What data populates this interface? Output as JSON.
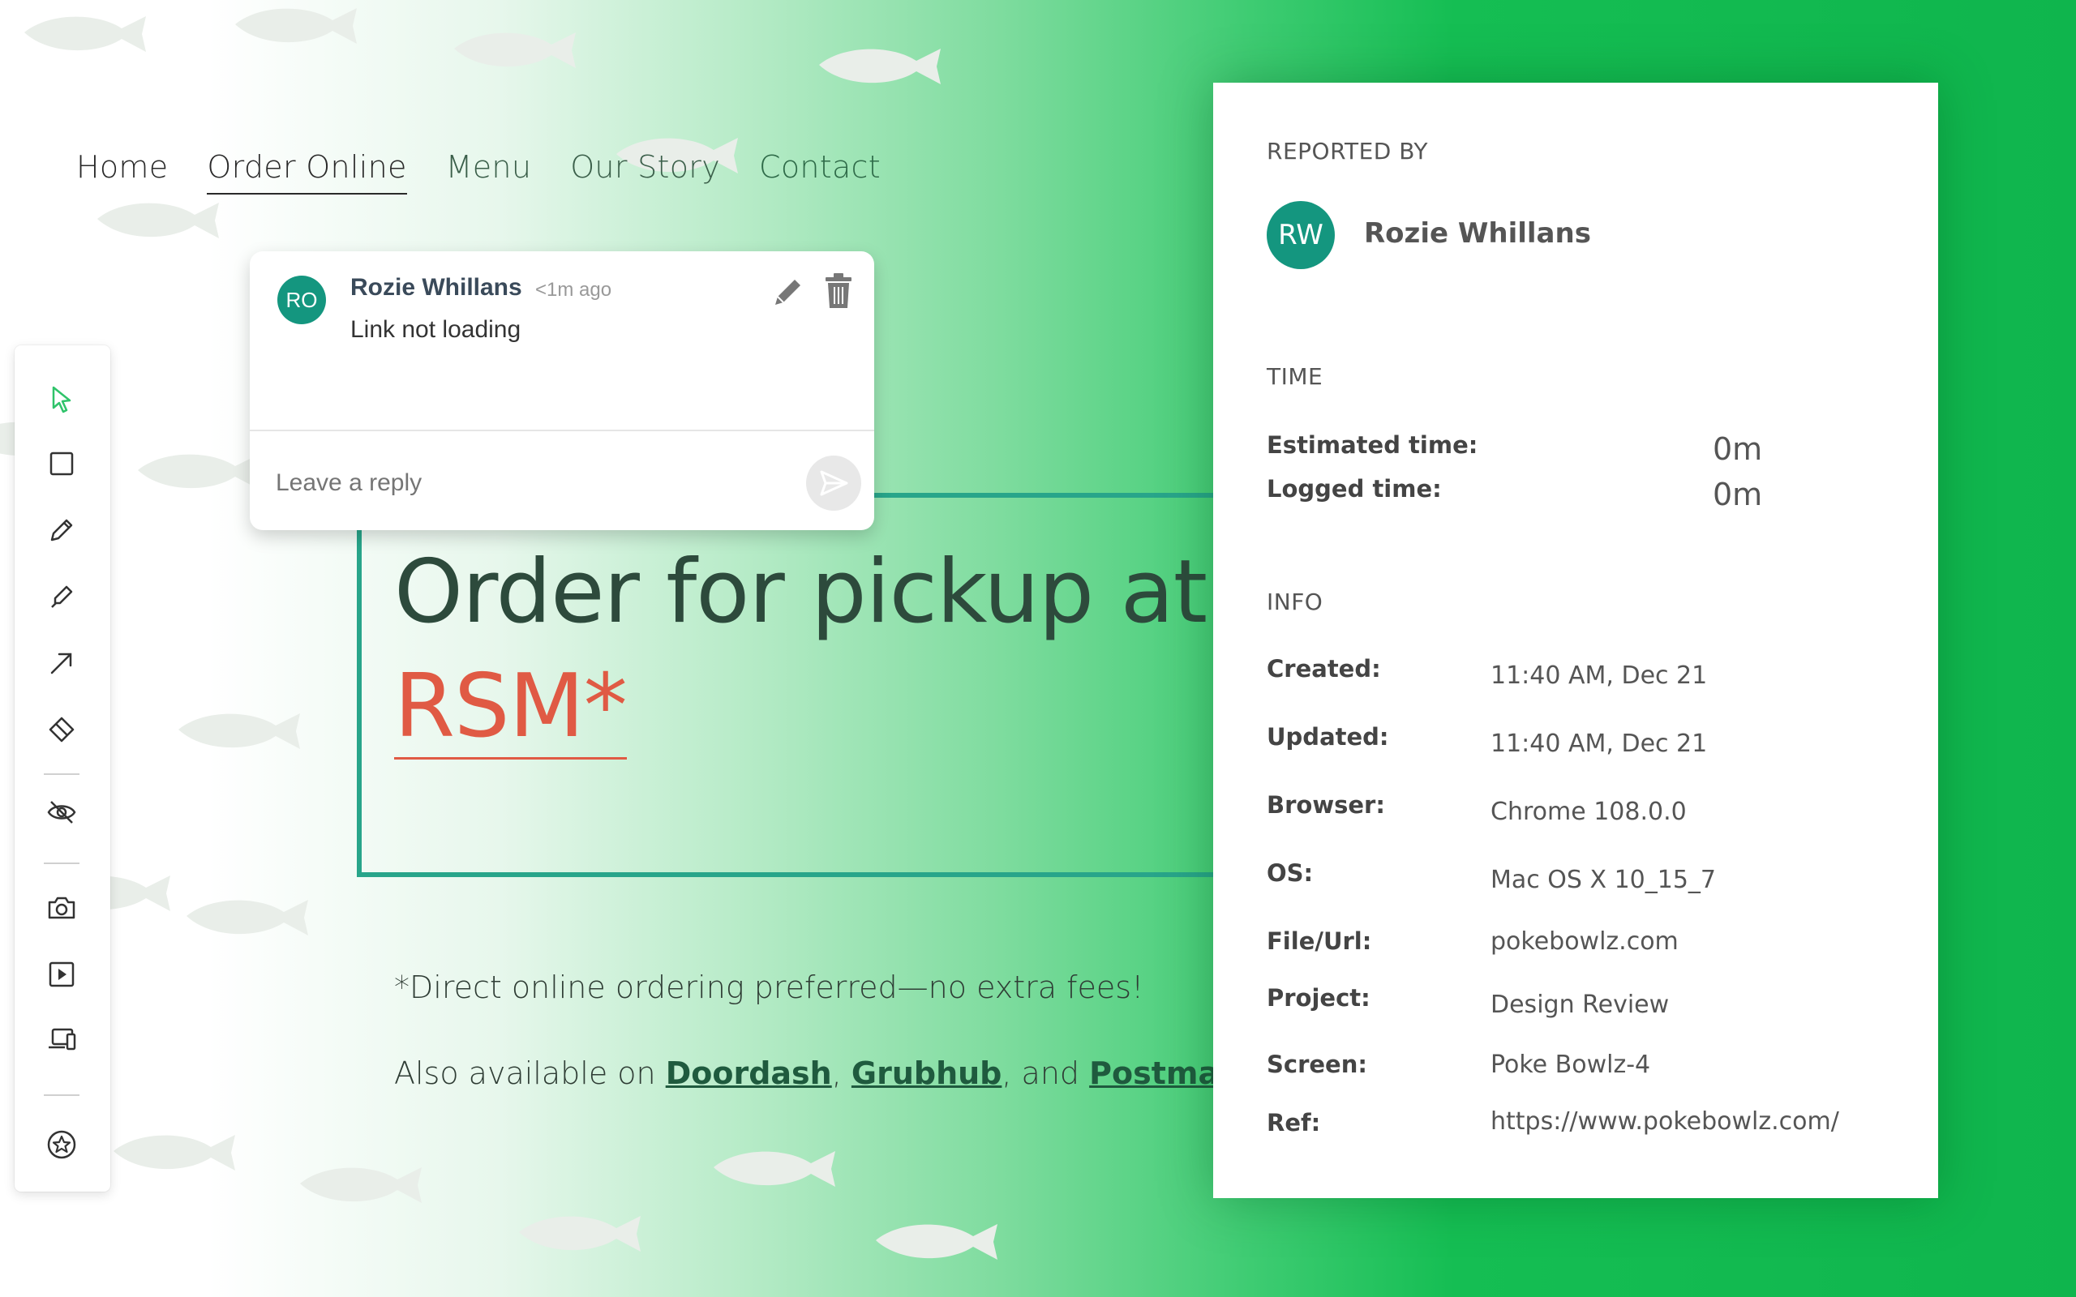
{
  "nav": {
    "items": [
      "Home",
      "Order Online",
      "Menu",
      "Our Story",
      "Contact"
    ]
  },
  "toolbar": {
    "tools": [
      "pointer-icon",
      "rectangle-icon",
      "pencil-icon",
      "highlighter-icon",
      "arrow-icon",
      "eraser-icon",
      "eye-off-icon",
      "camera-icon",
      "video-icon",
      "device-icon",
      "star-icon"
    ]
  },
  "hero": {
    "line1": "Order for pickup at",
    "line2": "RSM*",
    "note": "*Direct online ordering preferred—no extra fees!",
    "also_prefix": "Also available on ",
    "link1": "Doordash",
    "sep1": ", ",
    "link2": "Grubhub",
    "sep2": ", and ",
    "link3": "Postmates"
  },
  "comment": {
    "avatar": "RO",
    "author": "Rozie Whillans",
    "time": "<1m ago",
    "text": "Link not loading",
    "reply_placeholder": "Leave a reply"
  },
  "panel": {
    "reported_by_heading": "REPORTED BY",
    "reporter_avatar": "RW",
    "reporter_name": "Rozie Whillans",
    "time_heading": "TIME",
    "estimated_label": "Estimated time:",
    "estimated_value": "0m",
    "logged_label": "Logged time:",
    "logged_value": "0m",
    "info_heading": "INFO",
    "created_label": "Created:",
    "created_value": "11:40 AM, Dec 21",
    "updated_label": "Updated:",
    "updated_value": "11:40 AM, Dec 21",
    "browser_label": "Browser:",
    "browser_value": "Chrome 108.0.0",
    "os_label": "OS:",
    "os_value": "Mac OS X 10_15_7",
    "url_label": "File/Url:",
    "url_value": "pokebowlz.com",
    "project_label": "Project:",
    "project_value": "Design Review",
    "screen_label": "Screen:",
    "screen_value": "Poke Bowlz-4",
    "ref_label": "Ref:",
    "ref_value": "https://www.pokebowlz.com/"
  },
  "colors": {
    "accent_green": "#0fb54d",
    "avatar_teal": "#14967f",
    "hero_border": "#28a58a",
    "rsm_red": "#e05a44"
  }
}
